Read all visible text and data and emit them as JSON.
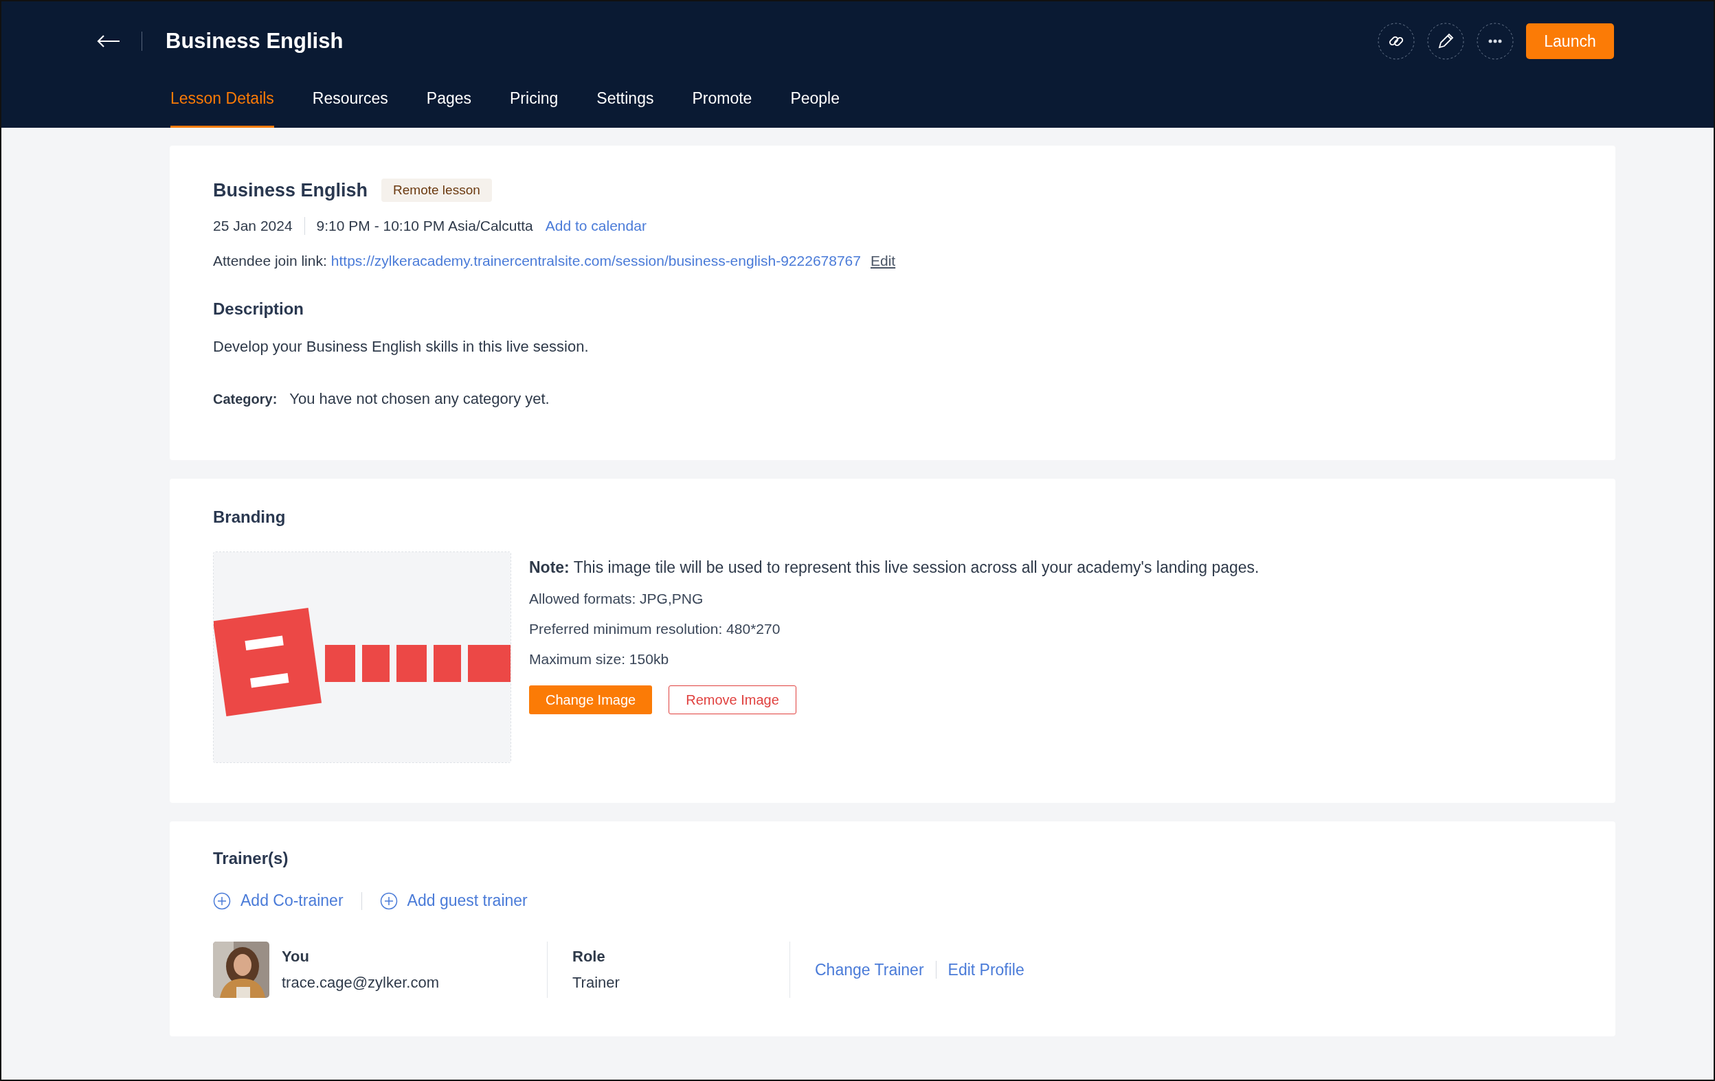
{
  "header": {
    "title": "Business English",
    "launch_button": "Launch"
  },
  "tabs": [
    {
      "label": "Lesson Details",
      "selected": true
    },
    {
      "label": "Resources",
      "selected": false
    },
    {
      "label": "Pages",
      "selected": false
    },
    {
      "label": "Pricing",
      "selected": false
    },
    {
      "label": "Settings",
      "selected": false
    },
    {
      "label": "Promote",
      "selected": false
    },
    {
      "label": "People",
      "selected": false
    }
  ],
  "lesson": {
    "title": "Business English",
    "badge": "Remote lesson",
    "date": "25 Jan 2024",
    "time": "9:10 PM - 10:10 PM Asia/Calcutta",
    "calendar_link": "Add to calendar",
    "join_label": "Attendee join link:",
    "join_url": "https://zylkeracademy.trainercentralsite.com/session/business-english-9222678767",
    "edit_link": "Edit",
    "description_heading": "Description",
    "description": "Develop your Business English skills in this live session.",
    "category_label": "Category:",
    "category_value": "You have not chosen any category yet."
  },
  "branding": {
    "heading": "Branding",
    "note": "**Note:** This image tile will be used to represent this live session across all your academy's landing pages.",
    "details": [
      "Allowed formats: JPG,PNG",
      "Preferred minimum resolution: 480*270",
      "Maximum size: 150kb"
    ],
    "change_button": "Change Image",
    "remove_button": "Remove Image"
  },
  "trainers": {
    "heading": "Trainer(s)",
    "add_actions": [
      "Add Co-trainer",
      "Add guest trainer"
    ],
    "list": [
      {
        "name": "You",
        "email": "trace.cage@zylker.com",
        "role_label": "Role",
        "role": "Trainer",
        "actions": [
          "Change Trainer",
          "Edit Profile"
        ]
      }
    ]
  }
}
